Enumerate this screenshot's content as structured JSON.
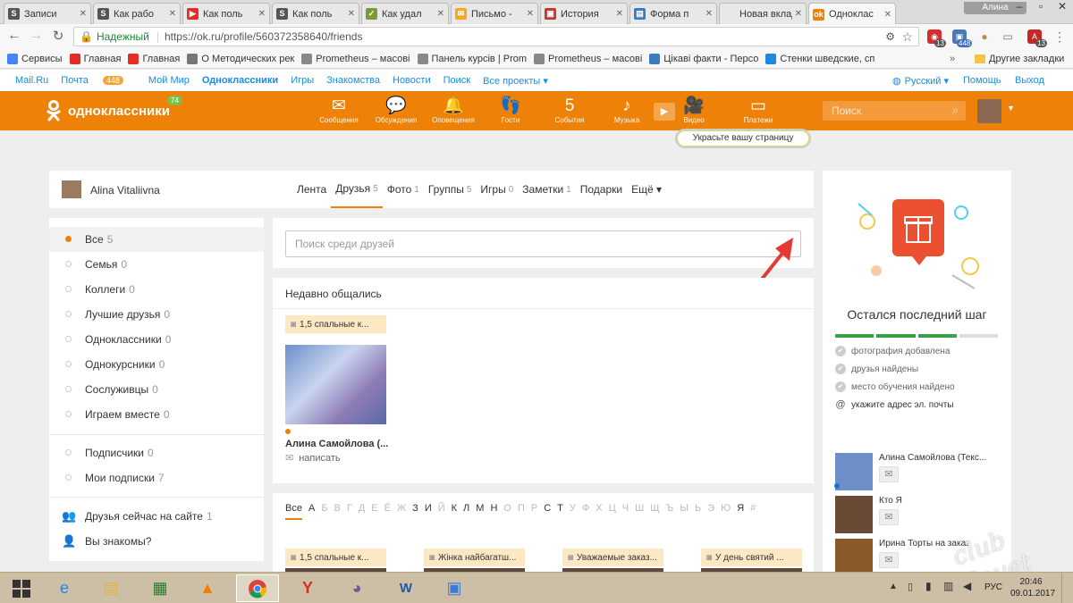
{
  "browser": {
    "tabs": [
      {
        "title": "Записи",
        "icon_color": "#555555",
        "icon_text": "S"
      },
      {
        "title": "Как рабо",
        "icon_color": "#555555",
        "icon_text": "S"
      },
      {
        "title": "Как поль",
        "icon_color": "#e52d27",
        "icon_text": "▶"
      },
      {
        "title": "Как поль",
        "icon_color": "#555555",
        "icon_text": "S"
      },
      {
        "title": "Как удал",
        "icon_color": "#7a9a3a",
        "icon_text": "✓"
      },
      {
        "title": "Письмо -",
        "icon_color": "#f5a623",
        "icon_text": "✉"
      },
      {
        "title": "История",
        "icon_color": "#c0392b",
        "icon_text": "▣"
      },
      {
        "title": "Форма п",
        "icon_color": "#3b7bbf",
        "icon_text": "▤"
      },
      {
        "title": "Новая вкладк",
        "icon_color": "",
        "icon_text": ""
      },
      {
        "title": "Одноклас",
        "icon_color": "#ee8208",
        "icon_text": "ok",
        "active": true
      }
    ],
    "profile_name": "Алина",
    "secure_label": "Надежный",
    "url": "https://ok.ru/profile/560372358640/friends",
    "ext_badges": [
      "13",
      "448",
      "13"
    ],
    "bookmarks": [
      {
        "label": "Сервисы",
        "icon_color": "#4285f4"
      },
      {
        "label": "Главная",
        "icon_color": "#e52d27"
      },
      {
        "label": "Главная",
        "icon_color": "#e52d27"
      },
      {
        "label": "О Методических рек",
        "icon_color": "#777777"
      },
      {
        "label": "Prometheus – масові",
        "icon_color": "#888888"
      },
      {
        "label": "Панель курсів | Prom",
        "icon_color": "#888888"
      },
      {
        "label": "Prometheus – масові",
        "icon_color": "#888888"
      },
      {
        "label": "Цікаві факти - Персо",
        "icon_color": "#3b7bbf"
      },
      {
        "label": "Стенки шведские, сп",
        "icon_color": "#1e88e5"
      }
    ],
    "other_bookmarks": "Другие закладки"
  },
  "mailbar": {
    "items": [
      "Mail.Ru",
      "Почта",
      "Мой Мир",
      "Одноклассники",
      "Игры",
      "Знакомства",
      "Новости",
      "Поиск",
      "Все проекты ▾"
    ],
    "mail_count": "448",
    "language": "Русский ▾",
    "help": "Помощь",
    "logout": "Выход"
  },
  "ok_header": {
    "logo": "одноклассники",
    "logo_badge": "74",
    "nav": [
      {
        "label": "Сообщения",
        "icon": "✉"
      },
      {
        "label": "Обсуждения",
        "icon": "💬"
      },
      {
        "label": "Оповещения",
        "icon": "🔔"
      },
      {
        "label": "Гости",
        "icon": "👣"
      },
      {
        "label": "События",
        "icon": "5"
      },
      {
        "label": "Музыка",
        "icon": "♪"
      },
      {
        "label": "Видео",
        "icon": "🎥"
      },
      {
        "label": "Платежи",
        "icon": "▭"
      }
    ],
    "search_placeholder": "Поиск",
    "decorate": "Украсьте вашу страницу"
  },
  "profile": {
    "name": "Alina Vitaliivna",
    "tabs": [
      {
        "label": "Лента",
        "count": ""
      },
      {
        "label": "Друзья",
        "count": "5",
        "active": true
      },
      {
        "label": "Фото",
        "count": "1"
      },
      {
        "label": "Группы",
        "count": "5"
      },
      {
        "label": "Игры",
        "count": "0"
      },
      {
        "label": "Заметки",
        "count": "1"
      },
      {
        "label": "Подарки",
        "count": ""
      },
      {
        "label": "Ещё ▾",
        "count": ""
      }
    ]
  },
  "left_menu": {
    "groups": [
      {
        "label": "Все",
        "count": "5",
        "selected": true
      },
      {
        "label": "Семья",
        "count": "0"
      },
      {
        "label": "Коллеги",
        "count": "0"
      },
      {
        "label": "Лучшие друзья",
        "count": "0"
      },
      {
        "label": "Одноклассники",
        "count": "0"
      },
      {
        "label": "Однокурсники",
        "count": "0"
      },
      {
        "label": "Сослуживцы",
        "count": "0"
      },
      {
        "label": "Играем вместе",
        "count": "0"
      }
    ],
    "subscriptions": [
      {
        "label": "Подписчики",
        "count": "0"
      },
      {
        "label": "Мои подписки",
        "count": "7"
      }
    ],
    "online": {
      "label": "Друзья сейчас на сайте",
      "count": "1"
    },
    "maybe": {
      "label": "Вы знакомы?"
    }
  },
  "friends": {
    "search_placeholder": "Поиск среди друзей",
    "recent_title": "Недавно общались",
    "recent_card": {
      "chip": "1,5 спальные к...",
      "name": "Алина Самойлова (...",
      "action": "написать"
    },
    "alphabet": [
      "Все",
      "А",
      "Б",
      "В",
      "Г",
      "Д",
      "Е",
      "Ё",
      "Ж",
      "З",
      "И",
      "Й",
      "К",
      "Л",
      "М",
      "Н",
      "О",
      "П",
      "Р",
      "С",
      "Т",
      "У",
      "Ф",
      "Х",
      "Ц",
      "Ч",
      "Ш",
      "Щ",
      "Ъ",
      "Ы",
      "Ь",
      "Э",
      "Ю",
      "Я",
      "#"
    ],
    "alphabet_active": [
      "Все",
      "А",
      "З",
      "И",
      "К",
      "Л",
      "М",
      "Н",
      "С",
      "Т",
      "Я"
    ],
    "bottom_chips": [
      "1,5 спальные к...",
      "Жінка найбагатш...",
      "Уважаемые заказ...",
      "У день святий ..."
    ]
  },
  "right_panel": {
    "title": "Остался последний шаг",
    "progress": 0.75,
    "steps": [
      {
        "label": "фотография добавлена",
        "done": true
      },
      {
        "label": "друзья найдены",
        "done": true
      },
      {
        "label": "место обучения найдено",
        "done": true
      },
      {
        "label": "укажите адрес эл. почты",
        "done": false
      }
    ],
    "friends": [
      {
        "name": "Алина Самойлова (Текс..."
      },
      {
        "name": "Кто Я"
      },
      {
        "name": "Ирина Торты на заказ"
      }
    ]
  },
  "taskbar": {
    "lang": "РУС",
    "time": "20:46",
    "date": "09.01.2017"
  },
  "colors": {
    "ok_orange": "#ee8208",
    "link_blue": "#168de2"
  }
}
